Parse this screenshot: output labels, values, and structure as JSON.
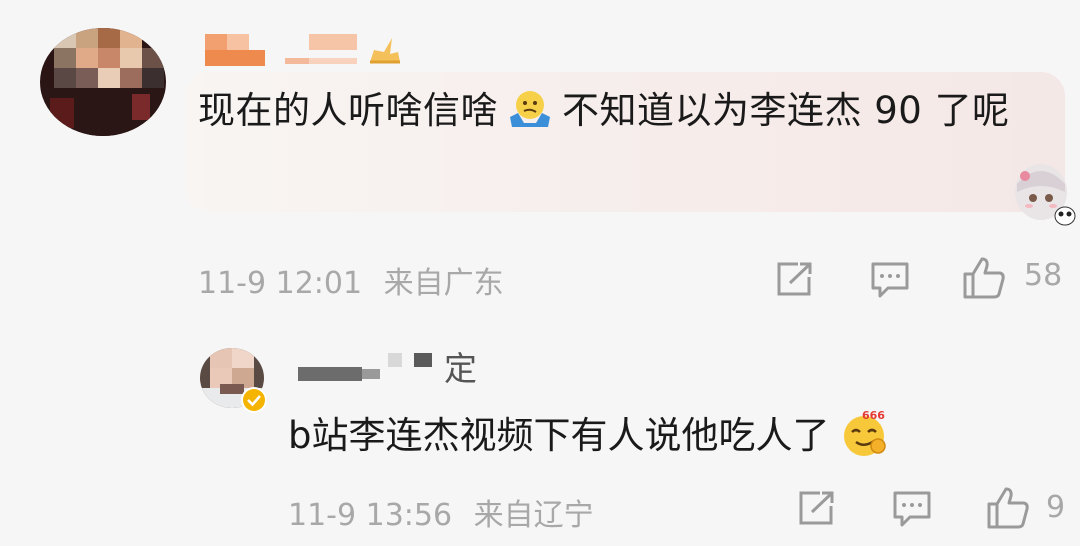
{
  "comment": {
    "text_before_emoji": "现在的人听啥信啥",
    "emoji_1": "shrug-emoji",
    "text_after_emoji": "不知道以为李连杰 90 了呢",
    "time": "11-9 12:01",
    "location": "来自广东",
    "like_count": "58"
  },
  "reply": {
    "username_visible_char": "定",
    "text": "b站李连杰视频下有人说他吃人了",
    "emoji": "666-sly-emoji",
    "time": "11-9 13:56",
    "location": "来自辽宁",
    "like_count": "9"
  },
  "icons": {
    "share": "share-icon",
    "comment": "comment-icon",
    "like": "thumbs-up-icon"
  },
  "colors": {
    "background": "#f6f6f6",
    "text": "#1a1a1a",
    "meta": "#a8a8a8",
    "badge": "#f5b400"
  }
}
